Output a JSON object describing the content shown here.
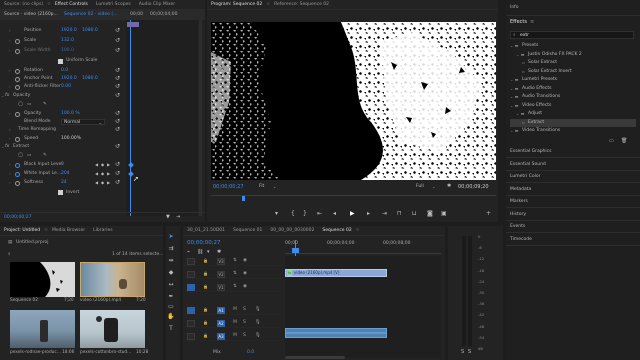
{
  "effect_controls": {
    "tabs": [
      "Source: (no clips)",
      "Effect Controls",
      "Lumetri Scopes",
      "Audio Clip Mixer"
    ],
    "clip_header": "Source · video (2160p...",
    "sequence_header": "Sequence 02 · video (...",
    "timecode_head": "00;00",
    "timecode_tail": "00;00;04;00",
    "position_label": "Position",
    "position_x": "1920.0",
    "position_y": "1080.0",
    "scale_label": "Scale",
    "scale_value": "132.0",
    "scale_width_label": "Scale Width",
    "scale_width_value": "100.0",
    "uniform_scale_label": "Uniform Scale",
    "rotation_label": "Rotation",
    "rotation_value": "0.0",
    "anchor_label": "Anchor Point",
    "anchor_x": "1920.0",
    "anchor_y": "1080.0",
    "antiflicker_label": "Anti-flicker Filter",
    "antiflicker_value": "0.00",
    "opacity_section": "Opacity",
    "opacity_label": "Opacity",
    "opacity_value": "100.0 %",
    "blend_label": "Blend Mode",
    "blend_value": "Normal",
    "time_remap_section": "Time Remapping",
    "speed_label": "Speed",
    "speed_value": "100.00%",
    "extract_section": "Extract",
    "black_input_label": "Black Input Level",
    "black_input_value": "0",
    "white_input_label": "White Input Le...",
    "white_input_value": "204",
    "softness_label": "Softness",
    "softness_value": "24",
    "invert_label": "Invert",
    "bottom_timecode": "00;00;00;27"
  },
  "program": {
    "tabs": [
      "Program: Sequence 02",
      "Reference: Sequence 02"
    ],
    "timecode": "00;00;00;27",
    "fit_label": "Fit",
    "quality_label": "Full",
    "duration": "00;00;09;20"
  },
  "effects": {
    "top_label": "Info",
    "title": "Effects",
    "search_value": "extr",
    "tree": [
      {
        "label": "Presets",
        "indent": 1,
        "kind": "folder"
      },
      {
        "label": "Justin Odisho FX PACK 2",
        "indent": 2,
        "kind": "folder"
      },
      {
        "label": "Solar Extract",
        "indent": 3,
        "kind": "item"
      },
      {
        "label": "Solar Extract Invert",
        "indent": 3,
        "kind": "item"
      },
      {
        "label": "Lumetri Presets",
        "indent": 1,
        "kind": "folder"
      },
      {
        "label": "Audio Effects",
        "indent": 1,
        "kind": "folder"
      },
      {
        "label": "Audio Transitions",
        "indent": 1,
        "kind": "folder"
      },
      {
        "label": "Video Effects",
        "indent": 1,
        "kind": "folder"
      },
      {
        "label": "Adjust",
        "indent": 2,
        "kind": "folder"
      },
      {
        "label": "Extract",
        "indent": 3,
        "kind": "item",
        "selected": true
      },
      {
        "label": "Video Transitions",
        "indent": 1,
        "kind": "folder"
      }
    ],
    "side_panels": [
      "Essential Graphics",
      "Essential Sound",
      "Lumetri Color",
      "Metadata",
      "Markers",
      "History",
      "Events",
      "Timecode"
    ]
  },
  "project": {
    "tabs": [
      "Project: Untitled",
      "Media Browser",
      "Libraries"
    ],
    "file_name": "Untitled.prproj",
    "item_count": "1 of 14 items selecte...",
    "items": [
      {
        "name": "Sequence 02",
        "duration": "7;20"
      },
      {
        "name": "video (2160p).mp4",
        "duration": "7:20"
      },
      {
        "name": "pexels-rodnae-produc...",
        "duration": "18:06"
      },
      {
        "name": "pexels-cottonbro-stud...",
        "duration": "10:28"
      }
    ]
  },
  "timeline": {
    "tabs": [
      "30_01_21.50D01",
      "Sequence 01",
      "00_00_00_0030002",
      "Sequence 02"
    ],
    "timecode": "00;00;00;27",
    "ruler_labels": [
      "00;00",
      "00;00;04;00",
      "00;00;08;00"
    ],
    "clip_label": "video (2160p).mp4 [V]",
    "video_tracks": [
      "V3",
      "V2",
      "V1"
    ],
    "audio_tracks": [
      "A1",
      "A2",
      "A3"
    ],
    "mix_label": "Mix",
    "mix_value": "0.0"
  },
  "meter_labels": [
    "0",
    "-6",
    "-12",
    "-18",
    "-24",
    "-30",
    "-36",
    "-42",
    "-48",
    "-54",
    "dB"
  ]
}
